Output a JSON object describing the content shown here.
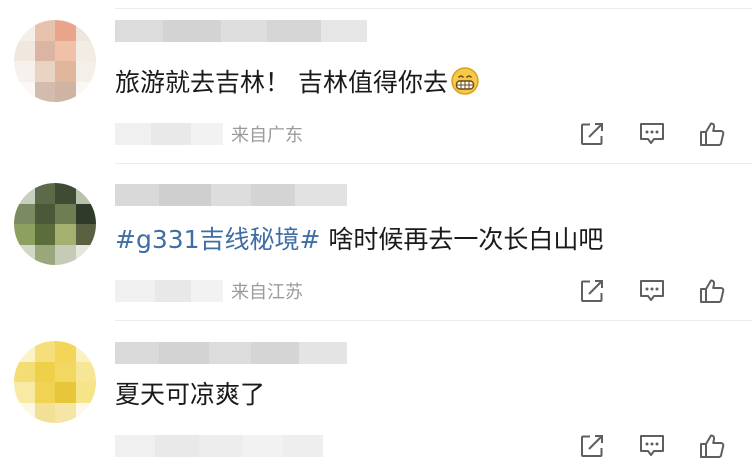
{
  "comments": [
    {
      "text": "旅游就去吉林！ 吉林值得你去",
      "emoji": "grinning-emoji",
      "source": "来自广东"
    },
    {
      "topic": "#g331吉线秘境#",
      "text": " 啥时候再去一次长白山吧",
      "source": "来自江苏"
    },
    {
      "text": "夏天可凉爽了",
      "source": ""
    }
  ],
  "actions": [
    "share-icon",
    "reply-icon",
    "like-icon"
  ]
}
